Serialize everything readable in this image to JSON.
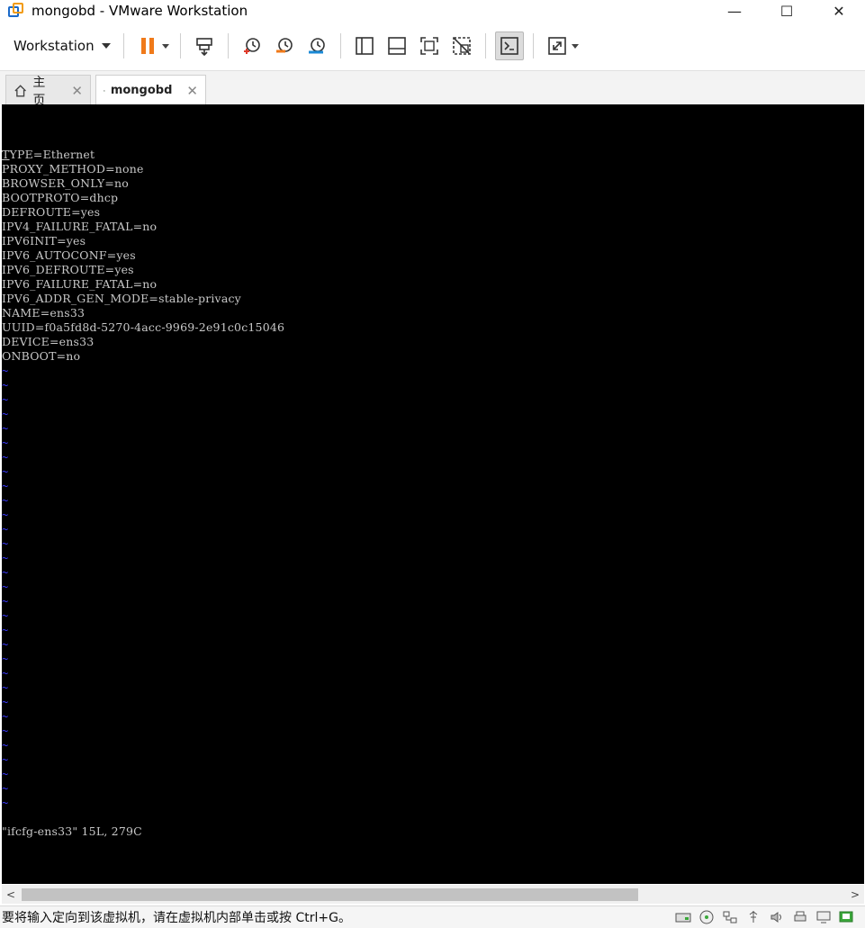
{
  "window": {
    "title": "mongobd - VMware Workstation",
    "controls": {
      "minimize": "—",
      "maximize": "☐",
      "close": "✕"
    }
  },
  "toolbar": {
    "workstation_label": "Workstation",
    "icons": [
      "pause-icon",
      "send-ctrl-alt-del-icon",
      "snapshot-icon",
      "revert-snapshot-icon",
      "snapshot-manager-icon",
      "library-icon",
      "thumbnail-bar-icon",
      "fullscreen-icon",
      "unity-icon",
      "console-view-icon",
      "stretch-icon"
    ]
  },
  "tabs": [
    {
      "label": "主页",
      "icon": "home-icon",
      "close": "✕"
    },
    {
      "label": "mongobd",
      "icon": "vm-running-icon",
      "close": "✕"
    }
  ],
  "console": {
    "lines": [
      "TYPE=Ethernet",
      "PROXY_METHOD=none",
      "BROWSER_ONLY=no",
      "BOOTPROTO=dhcp",
      "DEFROUTE=yes",
      "IPV4_FAILURE_FATAL=no",
      "IPV6INIT=yes",
      "IPV6_AUTOCONF=yes",
      "IPV6_DEFROUTE=yes",
      "IPV6_FAILURE_FATAL=no",
      "IPV6_ADDR_GEN_MODE=stable-privacy",
      "NAME=ens33",
      "UUID=f0a5fd8d-5270-4acc-9969-2e91c0c15046",
      "DEVICE=ens33",
      "ONBOOT=no"
    ],
    "tilde_char": "~",
    "status_line": "\"ifcfg-ens33\" 15L, 279C"
  },
  "statusbar": {
    "text": "要将输入定向到该虚拟机，请在虚拟机内部单击或按 Ctrl+G。",
    "icons": [
      "hard-disk-icon",
      "cd-dvd-icon",
      "network-icon",
      "usb-icon",
      "sound-icon",
      "printer-icon",
      "display-icon",
      "message-icon"
    ]
  },
  "colors": {
    "console_bg": "#000000",
    "console_text": "#c8c8c8",
    "tilde": "#3a3aff",
    "pause_orange": "#f07a1a"
  }
}
